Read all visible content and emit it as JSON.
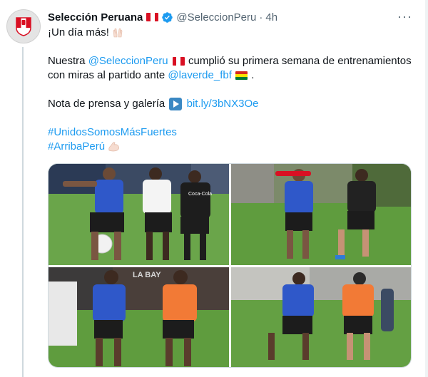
{
  "author": {
    "display_name": "Selección Peruana",
    "handle": "@SeleccionPeru",
    "separator": "·",
    "time": "4h",
    "verified": true
  },
  "menu_icon": "more-dots-icon",
  "tweet": {
    "line1": "¡Un día más!",
    "line2_prefix": "Nuestra ",
    "line2_mention": "@SeleccionPeru",
    "line2_suffix": " cumplió su primera semana de entrenamientos",
    "line3_prefix": "con miras al partido ante ",
    "line3_mention": "@laverde_fbf",
    "line3_suffix": " .",
    "line4_prefix": "Nota de prensa y galería ",
    "line4_link": "bit.ly/3bNX3Oe",
    "hashtag1": "#UnidosSomosMásFuertes",
    "hashtag2": "#ArribaPerú"
  },
  "photos": [
    {
      "name": "training-photo-1",
      "sponsor_text": "Coca-Cola"
    },
    {
      "name": "training-photo-2"
    },
    {
      "name": "training-photo-3",
      "banner_text": "LA BAY"
    },
    {
      "name": "training-photo-4"
    }
  ],
  "colors": {
    "link": "#1d9bf0",
    "muted": "#536471",
    "peru_red": "#d91023",
    "bib_blue": "#2f58c9",
    "bib_orange": "#f27a36",
    "grass": "#5f9c3e"
  }
}
